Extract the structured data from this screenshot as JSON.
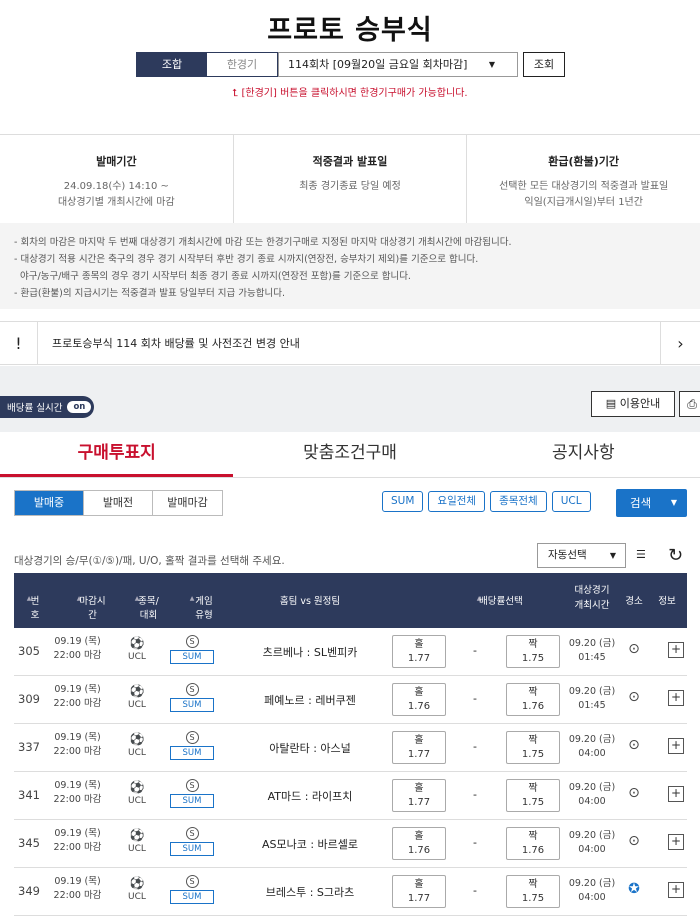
{
  "page": {
    "title": "프로토 승부식",
    "toggle": [
      "조합",
      "한경기"
    ],
    "round_select": "114회차 [09월20일 금요일 회차마감]",
    "view_button": "조회",
    "hint": "⮤ [한경기] 버튼을 클릭하시면 한경기구매가 가능합니다."
  },
  "info": [
    {
      "heading": "발매기간",
      "lines": [
        "24.09.18(수) 14:10 ~",
        "대상경기별 개최시간에 마감"
      ]
    },
    {
      "heading": "적중결과 발표일",
      "lines": [
        "최종 경기종료 당일 예정"
      ]
    },
    {
      "heading": "환급(환불)기간",
      "lines": [
        "선택한 모든 대상경기의 적중결과 발표일",
        "익일(지급개시일)부터 1년간"
      ]
    }
  ],
  "notes": [
    "- 회차의 마감은 마지막 두 번째 대상경기 개최시간에 마감 또는 한경기구매로 지정된 마지막 대상경기 개최시간에 마감됩니다.",
    "- 대상경기 적용 시간은 축구의 경우 경기 시작부터 후반 경기 종료 시까지(연장전, 승부차기 제외)를 기준으로 합니다.",
    "  야구/농구/배구 종목의 경우 경기 시작부터 최종 경기 종료 시까지(연장전 포함)를 기준으로 합니다.",
    "- 환급(환불)의 지급시기는 적중결과 발표 당일부터 지급 가능합니다."
  ],
  "notice": {
    "mark": "!",
    "text": "프로토승부식 114 회차 배당률 및 사전조건 변경 안내",
    "arrow": "›"
  },
  "realtime": {
    "label": "배당률 실시간",
    "state": "on"
  },
  "guide_button": "이용안내",
  "tabs": [
    "구매투표지",
    "맞춤조건구매",
    "공지사항"
  ],
  "segments": [
    "발매중",
    "발매전",
    "발매마감"
  ],
  "chips": [
    "SUM",
    "요일전체",
    "종목전체",
    "UCL"
  ],
  "search_button": "검색",
  "instruction": "대상경기의 승/무(①/⑤)/패, U/O, 홀짝 결과를 선택해 주세요.",
  "auto_select": "자동선택",
  "headers": {
    "num": "번호",
    "deadline": "마감시간",
    "league": "종목/대회",
    "game_type": "게임유형",
    "teams": "홈팀 vs 원정팀",
    "odds": "배당률선택",
    "match_time": "대상경기\n개최시간",
    "venue": "경소",
    "info": "정보"
  },
  "rows": [
    {
      "num": "305",
      "date": "09.19 (목)",
      "time": "22:00 마감",
      "league": "UCL",
      "type_icon": "S",
      "type": "SUM",
      "teams": "츠르베나 : SL벤피카",
      "home_label": "홀",
      "home_odd": "1.77",
      "dash": "-",
      "away_label": "짝",
      "away_odd": "1.75",
      "m_date": "09.20 (금)",
      "m_time": "01:45",
      "venue_icon": "map-pin"
    },
    {
      "num": "309",
      "date": "09.19 (목)",
      "time": "22:00 마감",
      "league": "UCL",
      "type_icon": "S",
      "type": "SUM",
      "teams": "페예노르 : 레버쿠젠",
      "home_label": "홀",
      "home_odd": "1.76",
      "dash": "-",
      "away_label": "짝",
      "away_odd": "1.76",
      "m_date": "09.20 (금)",
      "m_time": "01:45",
      "venue_icon": "map-pin"
    },
    {
      "num": "337",
      "date": "09.19 (목)",
      "time": "22:00 마감",
      "league": "UCL",
      "type_icon": "S",
      "type": "SUM",
      "teams": "아탈란타 : 아스널",
      "home_label": "홀",
      "home_odd": "1.77",
      "dash": "-",
      "away_label": "짝",
      "away_odd": "1.75",
      "m_date": "09.20 (금)",
      "m_time": "04:00",
      "venue_icon": "map-pin"
    },
    {
      "num": "341",
      "date": "09.19 (목)",
      "time": "22:00 마감",
      "league": "UCL",
      "type_icon": "S",
      "type": "SUM",
      "teams": "AT마드 : 라이프치",
      "home_label": "홀",
      "home_odd": "1.77",
      "dash": "-",
      "away_label": "짝",
      "away_odd": "1.75",
      "m_date": "09.20 (금)",
      "m_time": "04:00",
      "venue_icon": "map-pin"
    },
    {
      "num": "345",
      "date": "09.19 (목)",
      "time": "22:00 마감",
      "league": "UCL",
      "type_icon": "S",
      "type": "SUM",
      "teams": "AS모나코 : 바르셀로",
      "home_label": "홀",
      "home_odd": "1.76",
      "dash": "-",
      "away_label": "짝",
      "away_odd": "1.76",
      "m_date": "09.20 (금)",
      "m_time": "04:00",
      "venue_icon": "map-pin"
    },
    {
      "num": "349",
      "date": "09.19 (목)",
      "time": "22:00 마감",
      "league": "UCL",
      "type_icon": "S",
      "type": "SUM",
      "teams": "브레스투 : S그라츠",
      "home_label": "홀",
      "home_odd": "1.77",
      "dash": "-",
      "away_label": "짝",
      "away_odd": "1.75",
      "m_date": "09.20 (금)",
      "m_time": "04:00",
      "venue_icon": "star-pin"
    }
  ],
  "colors": {
    "navy": "#2d3a5c",
    "accent_red": "#c8102e",
    "blue": "#1a73c8"
  }
}
